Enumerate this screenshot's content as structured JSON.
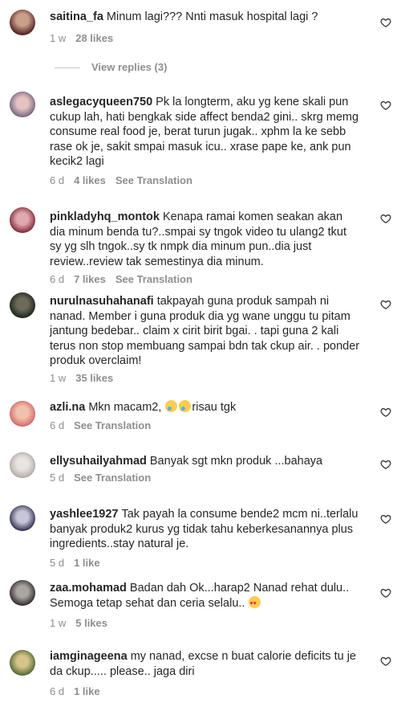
{
  "colors": {
    "muted": "#8e8e8e",
    "text": "#262626",
    "heart_outline": "#262626"
  },
  "comments": [
    {
      "username": "saitina_fa",
      "text": "Minum lagi??? Nnti masuk hospital lagi ?",
      "time": "1 w",
      "likes": "28 likes",
      "translation": ""
    },
    {
      "username": "aslegacyqueen750",
      "text": "Pk la longterm, aku yg kene skali pun cukup lah, hati bengkak side affect benda2 gini.. skrg memg consume real food je, berat turun jugak.. xphm la ke sebb rase ok je, sakit smpai masuk icu.. xrase pape ke, ank pun kecik2 lagi",
      "time": "6 d",
      "likes": "4 likes",
      "translation": "See Translation"
    },
    {
      "username": "pinkladyhq_montok",
      "text": "Kenapa ramai komen seakan akan dia minum benda tu?..smpai sy tngok video tu ulang2 tkut sy yg slh tngok..sy tk nmpk dia minum pun..dia just review..review tak semestinya dia minum.",
      "time": "6 d",
      "likes": "7 likes",
      "translation": "See Translation"
    },
    {
      "username": "nurulnasuhahanafi",
      "text": "takpayah guna produk sampah ni nanad. Member i guna produk dia yg wane unggu tu pitam jantung bedebar.. claim x cirit birit bgai. . tapi guna 2 kali terus non stop membuang sampai bdn tak ckup air. . ponder produk overclaim!",
      "time": "1 w",
      "likes": "35 likes",
      "translation": ""
    },
    {
      "username": "azli.na",
      "text": "Mkn macam2,",
      "text_after": "risau tgk",
      "time": "6 d",
      "likes": "",
      "translation": "See Translation"
    },
    {
      "username": "ellysuhailyahmad",
      "text": "Banyak sgt mkn produk ...bahaya",
      "time": "5 d",
      "likes": "",
      "translation": "See Translation"
    },
    {
      "username": "yashlee1927",
      "text": "Tak payah la consume bende2 mcm ni..terlalu banyak produk2 kurus yg tidak tahu keberkesanannya plus ingredients..stay natural je.",
      "time": "5 d",
      "likes": "1 like",
      "translation": ""
    },
    {
      "username": "zaa.mohamad",
      "text": "Badan dah Ok...harap2 Nanad rehat dulu.. Semoga tetap sehat dan ceria selalu..",
      "time": "1 w",
      "likes": "5 likes",
      "translation": ""
    },
    {
      "username": "iamginageena",
      "text": "my nanad, excse n buat calorie deficits tu je da ckup..... please.. jaga diri",
      "time": "6 d",
      "likes": "1 like",
      "translation": ""
    }
  ],
  "view_replies": "View replies (3)"
}
